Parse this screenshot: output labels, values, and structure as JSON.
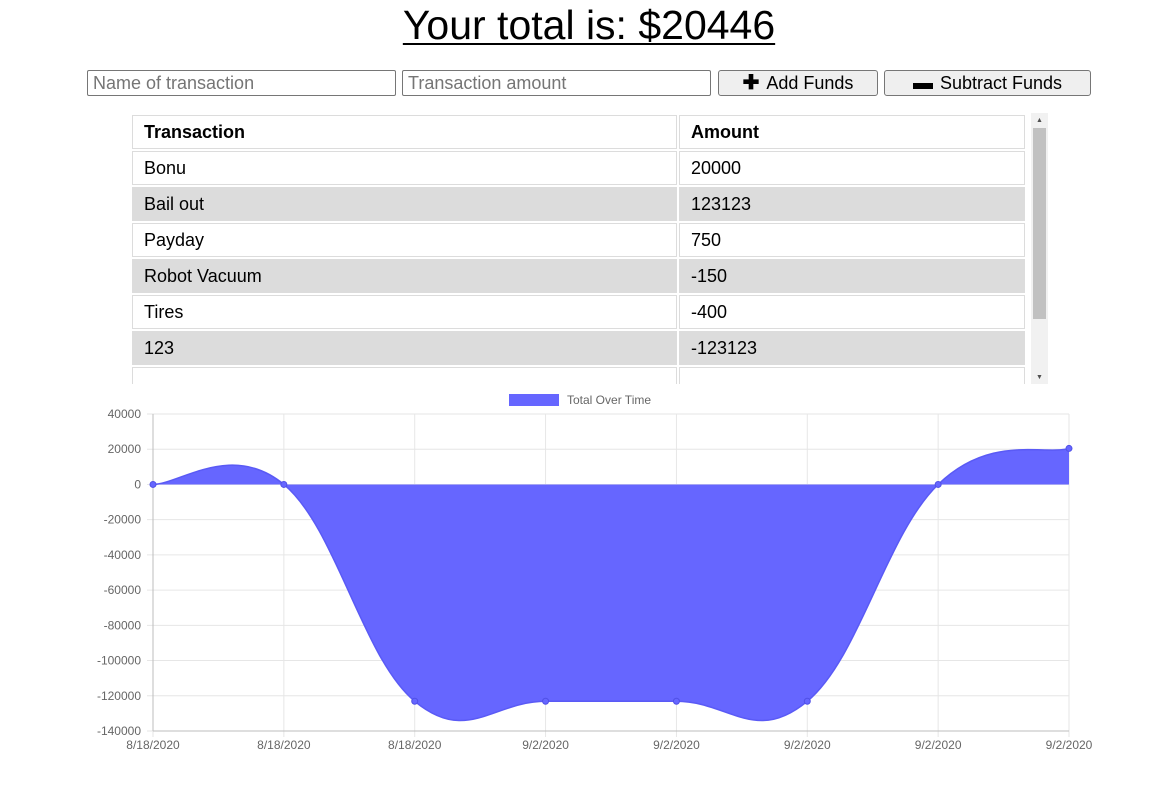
{
  "header": {
    "total_text": "Your total is: $20446"
  },
  "form": {
    "name_placeholder": "Name of transaction",
    "amount_placeholder": "Transaction amount",
    "add_label": "Add Funds",
    "subtract_label": "Subtract Funds",
    "add_icon": "plus-icon",
    "subtract_icon": "minus-icon"
  },
  "table": {
    "headers": [
      "Transaction",
      "Amount"
    ],
    "rows": [
      {
        "name": "Bonu",
        "amount": "20000"
      },
      {
        "name": "Bail out",
        "amount": "123123"
      },
      {
        "name": "Payday",
        "amount": "750"
      },
      {
        "name": "Robot Vacuum",
        "amount": "-150"
      },
      {
        "name": "Tires",
        "amount": "-400"
      },
      {
        "name": "123",
        "amount": "-123123"
      }
    ]
  },
  "chart_data": {
    "type": "area",
    "legend": "Total Over Time",
    "legend_position": "top-center",
    "color": "#6666ff",
    "x": [
      "8/18/2020",
      "8/18/2020",
      "8/18/2020",
      "9/2/2020",
      "9/2/2020",
      "9/2/2020",
      "9/2/2020",
      "9/2/2020"
    ],
    "values": [
      0,
      0,
      -123123,
      -123123,
      -123123,
      -123123,
      0,
      20446
    ],
    "ylim": [
      -140000,
      40000
    ],
    "yticks": [
      40000,
      20000,
      0,
      -20000,
      -40000,
      -60000,
      -80000,
      -100000,
      -120000,
      -140000
    ],
    "grid": true
  }
}
